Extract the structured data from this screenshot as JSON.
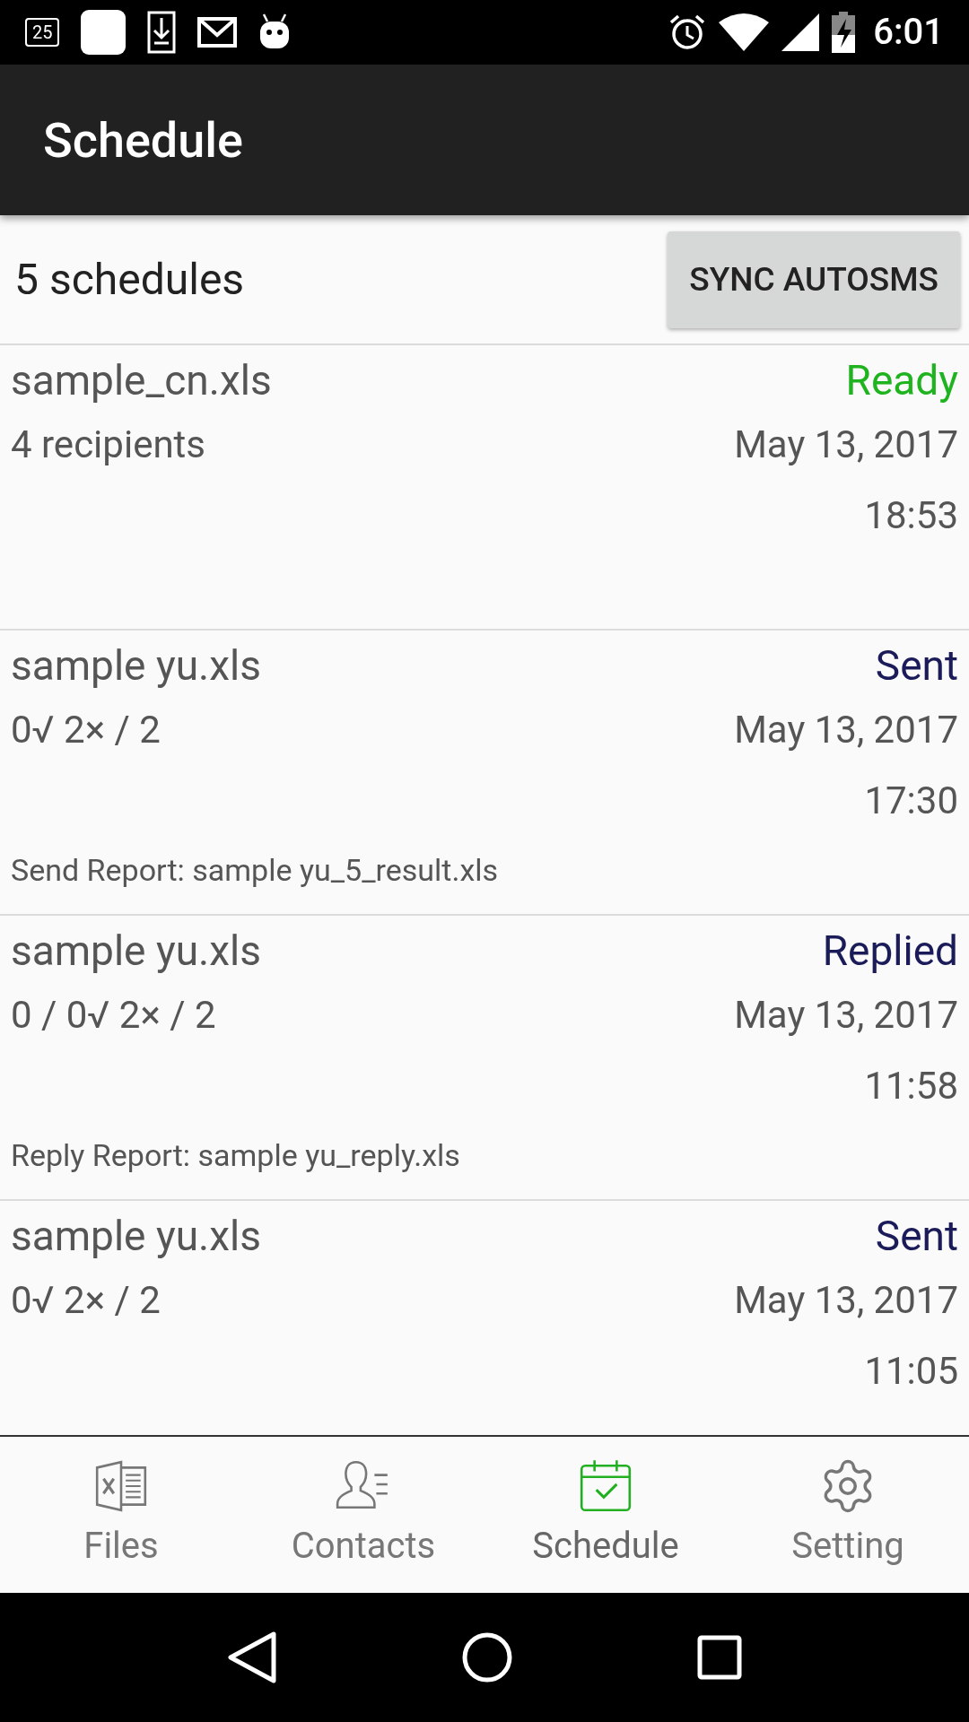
{
  "status_bar": {
    "badge": "25",
    "time": "6:01"
  },
  "app_bar": {
    "title": "Schedule"
  },
  "header": {
    "count": "5 schedules",
    "sync_button": "SYNC AUTOSMS"
  },
  "schedules": [
    {
      "file": "sample_cn.xls",
      "status": "Ready",
      "color": "#1fb41f",
      "counts": "4 recipients",
      "date": "May 13, 2017",
      "time": "18:53"
    },
    {
      "file": "sample yu.xls",
      "status": "Sent",
      "color": "#1b1b5a",
      "counts": "0√ 2× / 2",
      "date": "May 13, 2017",
      "time": "17:30",
      "report": "Send Report: sample yu_5_result.xls"
    },
    {
      "file": "sample yu.xls",
      "status": "Replied",
      "color": "#1b1b5a",
      "counts": "0 / 0√ 2× / 2",
      "date": "May 13, 2017",
      "time": "11:58",
      "report": "Reply Report: sample yu_reply.xls"
    },
    {
      "file": "sample yu.xls",
      "status": "Sent",
      "color": "#1b1b5a",
      "counts": "0√ 2× / 2",
      "date": "May 13, 2017",
      "time": "11:05"
    }
  ],
  "bottom_nav": [
    {
      "kind": "files",
      "label": "Files",
      "selected": false
    },
    {
      "kind": "contacts",
      "label": "Contacts",
      "selected": false
    },
    {
      "kind": "schedule",
      "label": "Schedule",
      "selected": true
    },
    {
      "kind": "setting",
      "label": "Setting",
      "selected": false
    }
  ]
}
